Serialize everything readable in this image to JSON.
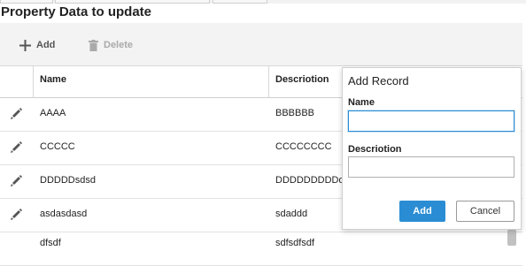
{
  "page": {
    "title": "Property Data to update"
  },
  "toolbar": {
    "add_label": "Add",
    "delete_label": "Delete"
  },
  "table": {
    "columns": [
      "Name",
      "Descriotion"
    ],
    "rows": [
      {
        "name": "AAAA",
        "description": "BBBBBB"
      },
      {
        "name": "CCCCC",
        "description": "CCCCCCCC"
      },
      {
        "name": "DDDDDsdsd",
        "description": "DDDDDDDDDd"
      },
      {
        "name": "asdasdasd",
        "description": "sdaddd"
      },
      {
        "name": "dfsdf",
        "description": "sdfsdfsdf"
      }
    ]
  },
  "dialog": {
    "title": "Add Record",
    "name_label": "Name",
    "name_value": "",
    "description_label": "Descriotion",
    "description_value": "",
    "add_label": "Add",
    "cancel_label": "Cancel"
  },
  "colors": {
    "accent": "#2a8dd4",
    "toolbar_bg": "#f3f3f3",
    "disabled_text": "#aaaaaa"
  }
}
